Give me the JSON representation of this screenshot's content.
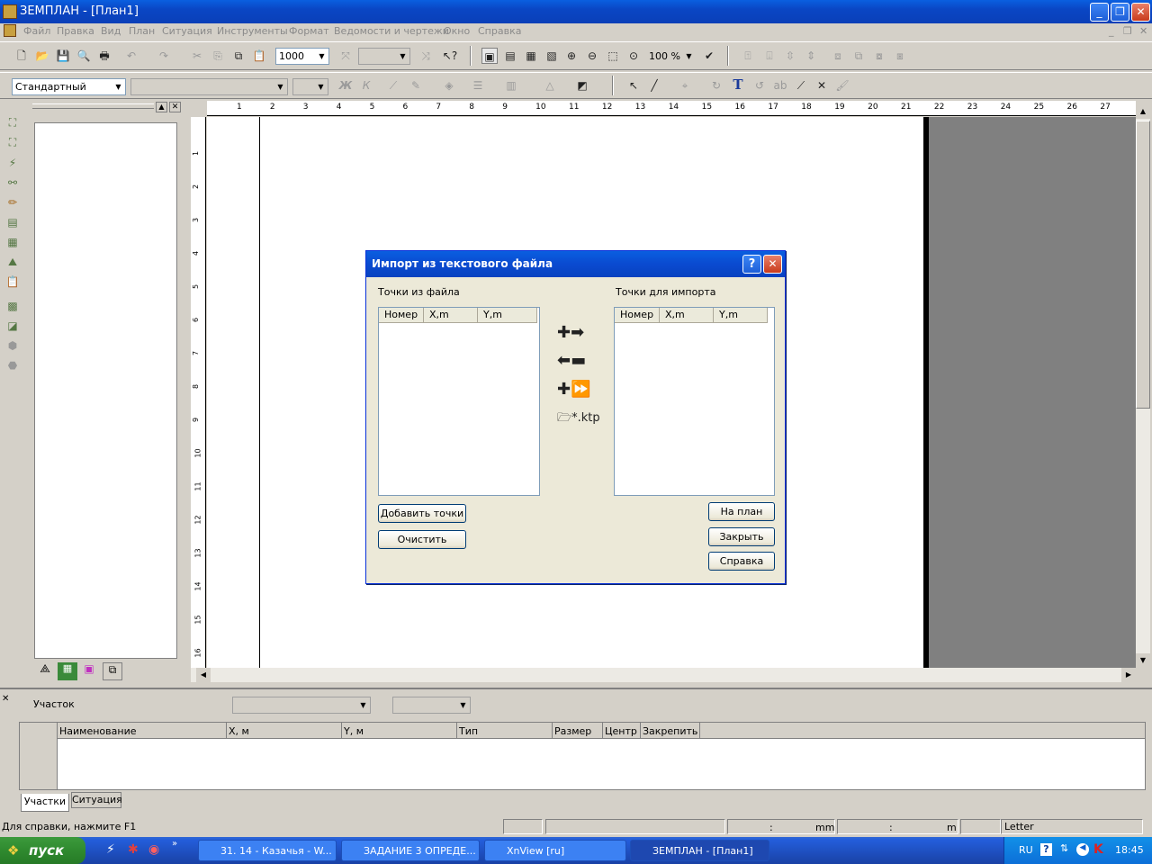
{
  "window": {
    "title": "ЗЕМПЛАН - [План1]"
  },
  "menu": [
    "Файл",
    "Правка",
    "Вид",
    "План",
    "Ситуация",
    "Инструменты",
    "Формат",
    "Ведомости и чертежи",
    "Окно",
    "Справка"
  ],
  "toolbar1": {
    "scale_value": "1000",
    "zoom_value": "100 %"
  },
  "toolbar2": {
    "style_value": "Стандартный",
    "bold_label": "Ж",
    "italic_label": "К",
    "text_tool_label": "T"
  },
  "ruler": {
    "h_marks": [
      "1",
      "2",
      "3",
      "4",
      "5",
      "6",
      "7",
      "8",
      "9",
      "10",
      "11",
      "12",
      "13",
      "14",
      "15",
      "16",
      "17",
      "18",
      "19",
      "20",
      "21",
      "22",
      "23",
      "24",
      "25",
      "26",
      "27"
    ],
    "v_marks": [
      "1",
      "2",
      "3",
      "4",
      "5",
      "6",
      "7",
      "8",
      "9",
      "10",
      "11",
      "12",
      "13",
      "14",
      "15",
      "16"
    ]
  },
  "dialog": {
    "title": "Импорт из текстового файла",
    "help_btn": "?",
    "close_btn": "✕",
    "left_label": "Точки из файла",
    "right_label": "Точки для импорта",
    "columns": [
      "Номер",
      "X,m",
      "Y,m"
    ],
    "file_label": "*.ktp",
    "add_points_btn": "Добавить точки",
    "clear_btn": "Очистить",
    "to_plan_btn": "На план",
    "close_label": "Закрыть",
    "help_label": "Справка"
  },
  "bottom_panel": {
    "section_label": "Участок",
    "columns": [
      "Наименование",
      "X, м",
      "Y, м",
      "Тип",
      "Размер",
      "Центр",
      "Закрепить"
    ],
    "tabs": [
      "Участки",
      "Ситуация"
    ]
  },
  "status": {
    "hint": "Для справки, нажмите F1",
    "coord_sep1": ":",
    "unit1": "mm",
    "coord_sep2": ":",
    "unit2": "m",
    "paper": "Letter"
  },
  "taskbar": {
    "start_label": "пуск",
    "tasks": [
      "31. 14 - Казачья - W...",
      "ЗАДАНИЕ 3 ОПРЕДЕ...",
      "XnView [ru]",
      "ЗЕМПЛАН - [План1]"
    ],
    "lang": "RU",
    "clock": "18:45"
  }
}
